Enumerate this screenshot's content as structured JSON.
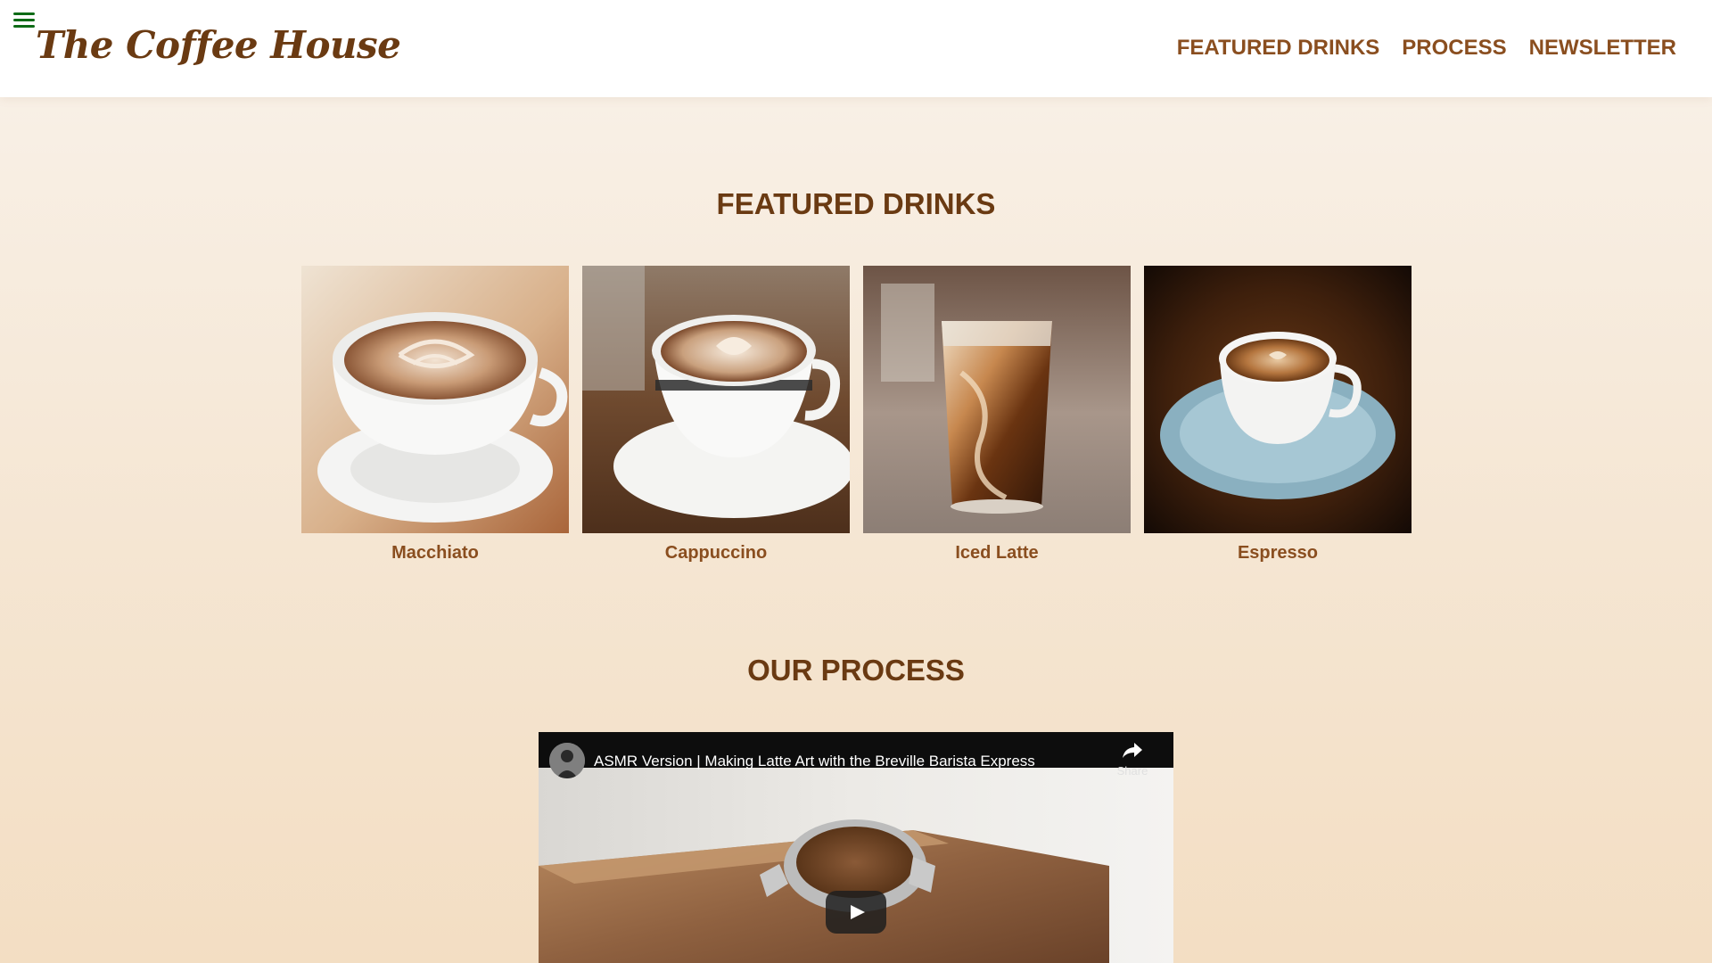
{
  "header": {
    "logo": "The Coffee House",
    "menu_icon": "hamburger-icon",
    "nav": [
      "FEATURED DRINKS",
      "PROCESS",
      "NEWSLETTER"
    ]
  },
  "featured": {
    "title": "FEATURED DRINKS",
    "drinks": [
      {
        "name": "Macchiato"
      },
      {
        "name": "Cappuccino"
      },
      {
        "name": "Iced Latte"
      },
      {
        "name": "Espresso"
      }
    ]
  },
  "process": {
    "title": "OUR PROCESS",
    "video": {
      "title": "ASMR Version | Making Latte Art with the Breville Barista Express",
      "share_label": "Share",
      "share_icon": "share-icon",
      "play_icon": "play-icon"
    }
  },
  "colors": {
    "brand_brown": "#6a3a12",
    "nav_brown": "#8a4e1f",
    "menu_green": "#0e6b16"
  }
}
